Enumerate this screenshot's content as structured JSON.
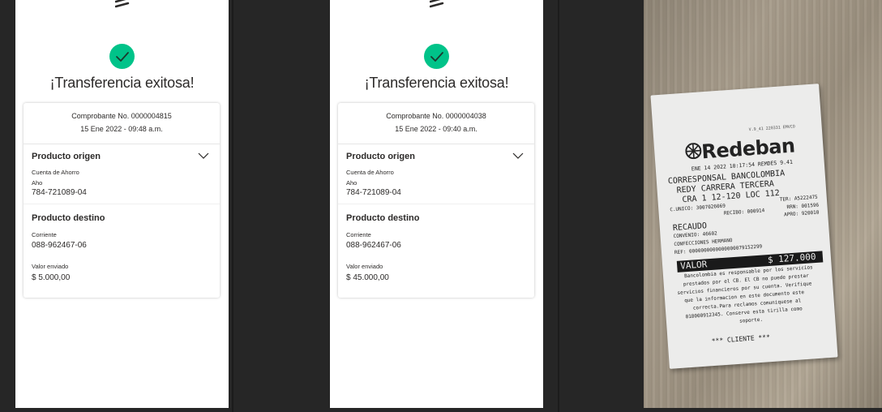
{
  "phones": [
    {
      "title": "¡Transferencia exitosa!",
      "voucher": "Comprobante No. 0000004815",
      "date": "15 Ene 2022 - 09:48 a.m.",
      "origin_title": "Producto origen",
      "origin_type": "Cuenta de Ahorro",
      "origin_sub": "Aho",
      "origin_number": "784-721089-04",
      "dest_title": "Producto destino",
      "dest_type": "Corriente",
      "dest_number": "088-962467-06",
      "amount_label": "Valor enviado",
      "amount": "$ 5.000,00"
    },
    {
      "title": "¡Transferencia exitosa!",
      "voucher": "Comprobante No. 0000004038",
      "date": "15 Ene 2022 - 09:40 a.m.",
      "origin_title": "Producto origen",
      "origin_type": "Cuenta de Ahorro",
      "origin_sub": "Aho",
      "origin_number": "784-721089-04",
      "dest_title": "Producto destino",
      "dest_type": "Corriente",
      "dest_number": "088-962467-06",
      "amount_label": "Valor enviado",
      "amount": "$ 45.000,00"
    }
  ],
  "receipt": {
    "version": "V.9_41 220331 EMVCO",
    "brand": "Redeban",
    "datetime": "ENE 14 2022 10:17:54 REMDES 9.41",
    "line1": "CORRESPONSAL BANCOLOMBIA",
    "line2": "REDY CARRERA TERCERA",
    "line3": "CRA 1 12-120 LOC 112",
    "code": "C.UNICO: 3007026069",
    "ter": "TER: A5222475",
    "recibo": "RECIBO: 000914",
    "rrn": "RRN: 001596",
    "apro": "APRO: 920010",
    "recaudo": "RECAUDO",
    "convenio": "CONVENIO: 46602",
    "company": "CONFECCIONES HERMANO",
    "ref": "REF: 0000000000000000079152299",
    "valor_label": "VALOR",
    "valor_amount": "$ 127.000",
    "disclaimer": [
      "Bancolombia es responsable por los servicios",
      "prestados por el CB. El CB no puede prestar",
      "servicios financieros por su cuenta. Verifique",
      "que la informacion en este documento este",
      "correcta.Para reclamos comuniquese al",
      "018000912345. Conserve esta tirilla como",
      "soporte."
    ],
    "footer": "*** CLIENTE ***"
  }
}
